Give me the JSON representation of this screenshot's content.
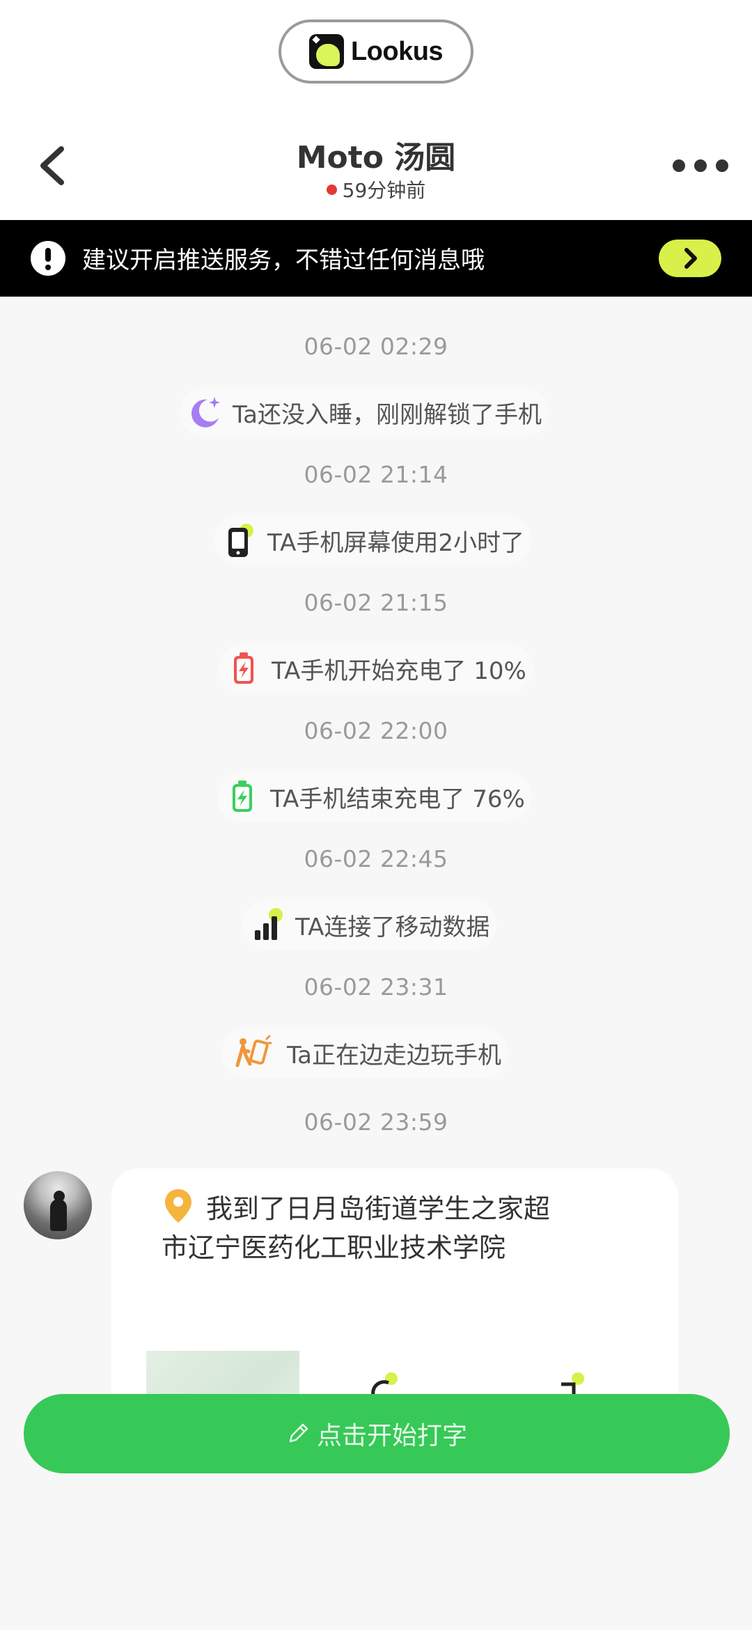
{
  "app": {
    "logo_text": "Lookus"
  },
  "header": {
    "title": "Moto 汤圆",
    "status": "59分钟前",
    "status_color": "#e53935"
  },
  "banner": {
    "text": "建议开启推送服务，不错过任何消息哦",
    "accent": "#d8f04a"
  },
  "timeline": [
    {
      "time": "06-02 02:29",
      "icon": "moon-icon",
      "text": "Ta还没入睡，刚刚解锁了手机"
    },
    {
      "time": "06-02 21:14",
      "icon": "phone-screen-icon",
      "text": "TA手机屏幕使用2小时了"
    },
    {
      "time": "06-02 21:15",
      "icon": "battery-charging-red-icon",
      "text": "TA手机开始充电了 10%"
    },
    {
      "time": "06-02 22:00",
      "icon": "battery-charging-green-icon",
      "text": "TA手机结束充电了 76%"
    },
    {
      "time": "06-02 22:45",
      "icon": "signal-bars-icon",
      "text": "TA连接了移动数据"
    },
    {
      "time": "06-02 23:31",
      "icon": "walking-phone-icon",
      "text": "Ta正在边走边玩手机"
    },
    {
      "time": "06-02 23:59"
    }
  ],
  "message": {
    "text": "我到了日月岛街道学生之家超市辽宁医药化工职业技术学院"
  },
  "input": {
    "placeholder": "点击开始打字"
  },
  "colors": {
    "brand_green": "#36c957",
    "accent_yellow": "#d8f04a",
    "icon_purple": "#a77df5",
    "icon_red": "#ef5350",
    "icon_green": "#3ccf5e",
    "icon_orange": "#f0963c"
  }
}
